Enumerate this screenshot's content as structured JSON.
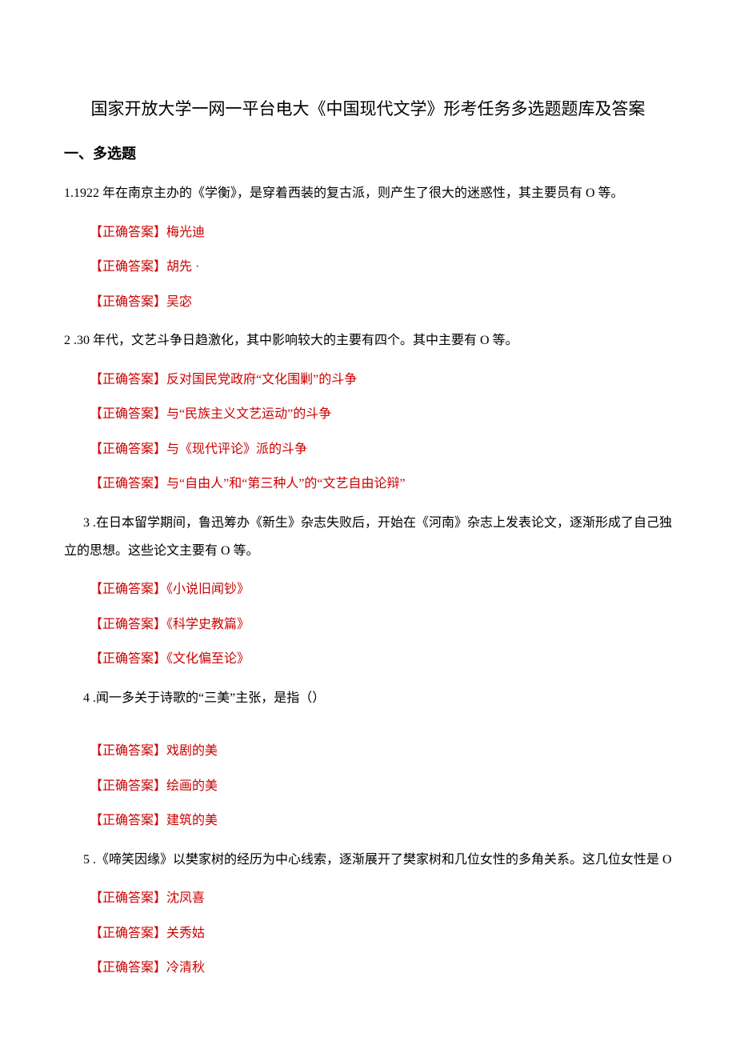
{
  "title": "国家开放大学一网一平台电大《中国现代文学》形考任务多选题题库及答案",
  "section_heading": "一、多选题",
  "answer_label": "【正确答案】",
  "questions": [
    {
      "number": "1.",
      "text": "1922 年在南京主办的《学衡》，是穿着西装的复古派，则产生了很大的迷惑性，其主要员有 O 等。",
      "indent": false,
      "answers": [
        "梅光迪",
        "胡先 ·",
        "吴宓"
      ]
    },
    {
      "number": "2 .",
      "text": "30 年代，文艺斗争日趋激化，其中影响较大的主要有四个。其中主要有 O 等。",
      "indent": false,
      "answers": [
        "反对国民党政府“文化围剿”的斗争",
        "与“民族主义文艺运动”的斗争",
        "与《现代评论》派的斗争",
        "与“自由人”和“第三种人”的“文艺自由论辩”"
      ]
    },
    {
      "number": "3 .",
      "text": "在日本留学期间，鲁迅筹办《新生》杂志失败后，开始在《河南》杂志上发表论文，逐渐形成了自己独立的思想。这些论文主要有 O 等。",
      "indent": true,
      "answers": [
        "《小说旧闻钞》",
        "《科学史教篇》",
        "《文化偏至论》"
      ]
    },
    {
      "number": "4 .",
      "text": "闻一多关于诗歌的“三美”主张，是指（）",
      "indent": true,
      "answers": [
        "戏剧的美",
        "绘画的美",
        "建筑的美"
      ]
    },
    {
      "number": "5 .",
      "text": "《啼笑因缘》以樊家树的经历为中心线索，逐渐展开了樊家树和几位女性的多角关系。这几位女性是 O",
      "indent": true,
      "answers": [
        "沈凤喜",
        "关秀姑",
        "冷清秋"
      ]
    }
  ]
}
